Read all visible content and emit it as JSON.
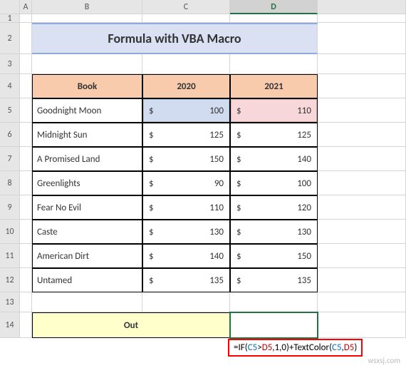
{
  "columns": [
    "",
    "A",
    "B",
    "C",
    "D",
    ""
  ],
  "active_column": "D",
  "rows": [
    "1",
    "2",
    "3",
    "4",
    "5",
    "6",
    "7",
    "8",
    "9",
    "10",
    "11",
    "12",
    "13",
    "14"
  ],
  "title": "Formula with VBA Macro",
  "headers": {
    "book": "Book",
    "y2020": "2020",
    "y2021": "2021"
  },
  "currency": "$",
  "data": [
    {
      "name": "Goodnight Moon",
      "y2020": "100",
      "y2021": "110"
    },
    {
      "name": "Midnight Sun",
      "y2020": "125",
      "y2021": "125"
    },
    {
      "name": "A Promised Land",
      "y2020": "150",
      "y2021": "140"
    },
    {
      "name": "Greenlights",
      "y2020": "90",
      "y2021": "100"
    },
    {
      "name": "Fear No Evil",
      "y2020": "110",
      "y2021": "120"
    },
    {
      "name": "Caste",
      "y2020": "130",
      "y2021": "130"
    },
    {
      "name": "American Dirt",
      "y2020": "140",
      "y2021": "150"
    },
    {
      "name": "Untamed",
      "y2020": "135",
      "y2021": "135"
    }
  ],
  "out_label": "Out",
  "formula": {
    "eq": "=",
    "if": "IF",
    "open": "(",
    "ref1": "C5",
    "gt": ">",
    "ref2": "D5",
    "comma": ",",
    "n1": "1",
    "n0": "0",
    "close": ")",
    "plus": "+",
    "fn2": "TextColor",
    "ref3": "C5",
    "ref4": "D5"
  },
  "watermark": "wsxsj.com"
}
